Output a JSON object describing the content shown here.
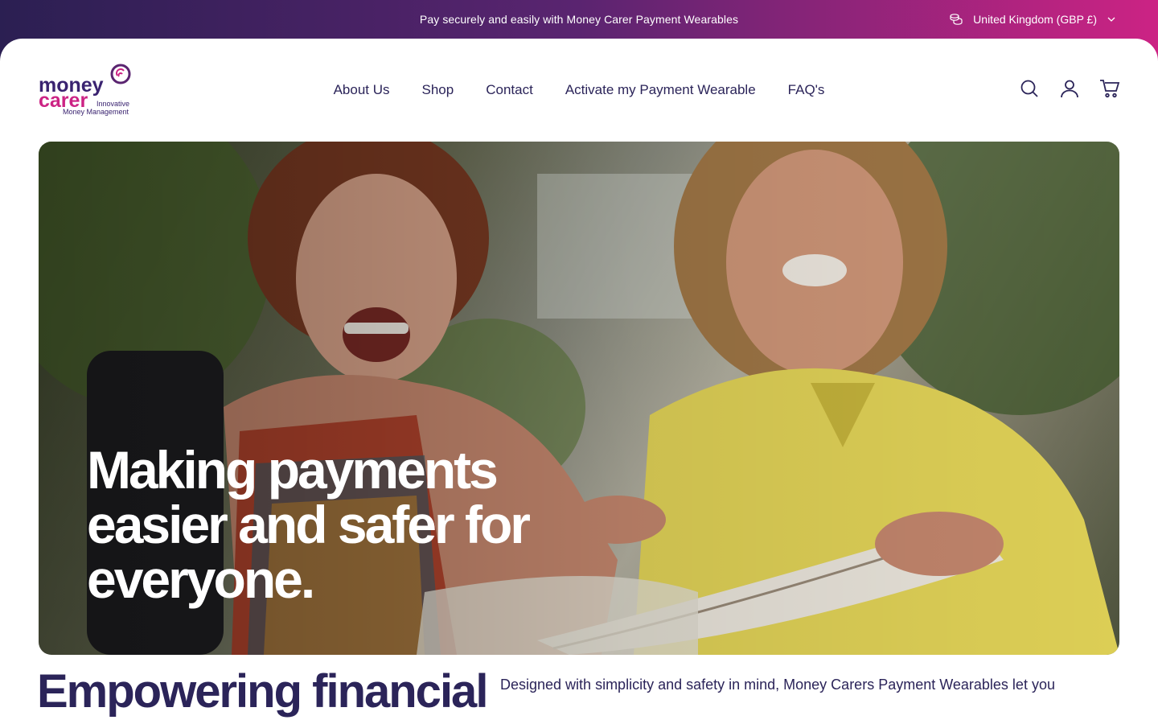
{
  "announcement": {
    "text": "Pay securely and easily with Money Carer Payment Wearables"
  },
  "country_selector": {
    "label": "United Kingdom (GBP £)"
  },
  "logo": {
    "line1": "money",
    "line2": "carer",
    "tag1": "Innovative",
    "tag2": "Money Management"
  },
  "nav": {
    "items": [
      {
        "label": "About Us"
      },
      {
        "label": "Shop"
      },
      {
        "label": "Contact"
      },
      {
        "label": "Activate my Payment Wearable"
      },
      {
        "label": "FAQ's"
      }
    ]
  },
  "header_icons": [
    "search-icon",
    "account-icon",
    "cart-icon"
  ],
  "hero": {
    "line1": "Making payments",
    "line2": "easier and safer for",
    "line3": "everyone."
  },
  "section": {
    "title": "Empowering financial",
    "description": "Designed with simplicity and safety in mind, Money Carers Payment Wearables let you"
  },
  "colors": {
    "brand_navy": "#2b2459",
    "brand_magenta": "#cc2384",
    "brand_purple": "#5a2470"
  }
}
